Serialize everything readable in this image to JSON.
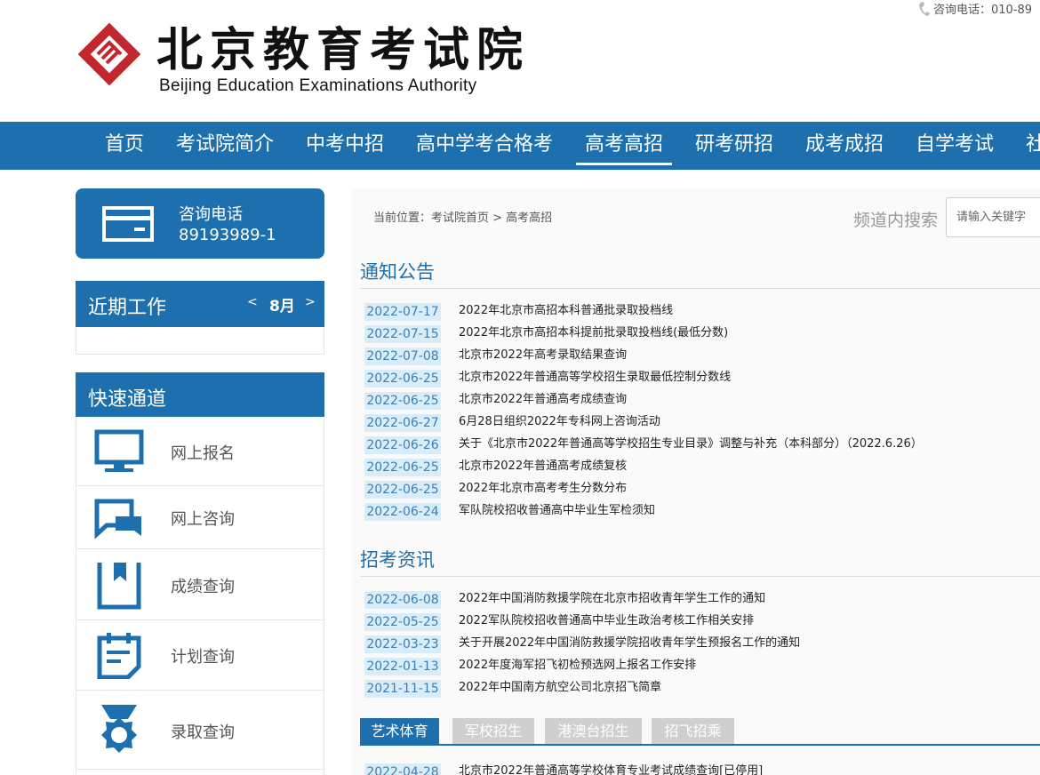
{
  "header": {
    "phone_text": "咨询电话：010-89",
    "title_cn": "北京教育考试院",
    "title_en": "Beijing Education Examinations Authority"
  },
  "nav": {
    "items": [
      "首页",
      "考试院简介",
      "中考中招",
      "高中学考合格考",
      "高考高招",
      "研考研招",
      "成考成招",
      "自学考试",
      "社"
    ],
    "active": "高考高招"
  },
  "sidebar": {
    "consult": {
      "label": "咨询电话",
      "number": "89193989-1"
    },
    "recent": {
      "title": "近期工作",
      "prev": "<",
      "month": "8月",
      "next": ">"
    },
    "quick": {
      "title": "快速通道",
      "items": [
        {
          "label": "网上报名",
          "icon": "monitor-icon"
        },
        {
          "label": "网上咨询",
          "icon": "chat-icon"
        },
        {
          "label": "成绩查询",
          "icon": "bookmark-icon"
        },
        {
          "label": "计划查询",
          "icon": "calendar-icon"
        },
        {
          "label": "录取查询",
          "icon": "medal-icon"
        }
      ]
    }
  },
  "main": {
    "breadcrumb": "当前位置：考试院首页 > 高考高招",
    "search_label": "频道内搜索",
    "search_placeholder": "请输入关键字",
    "notices": {
      "title": "通知公告",
      "items": [
        {
          "date": "2022-07-17",
          "title": "2022年北京市高招本科普通批录取投档线"
        },
        {
          "date": "2022-07-15",
          "title": "2022年北京市高招本科提前批录取投档线(最低分数)"
        },
        {
          "date": "2022-07-08",
          "title": "北京市2022年高考录取结果查询"
        },
        {
          "date": "2022-06-25",
          "title": "北京市2022年普通高等学校招生录取最低控制分数线"
        },
        {
          "date": "2022-06-25",
          "title": "北京市2022年普通高考成绩查询"
        },
        {
          "date": "2022-06-27",
          "title": "6月28日组织2022年专科网上咨询活动"
        },
        {
          "date": "2022-06-26",
          "title": "关于《北京市2022年普通高等学校招生专业目录》调整与补充（本科部分）（2022.6.26）"
        },
        {
          "date": "2022-06-25",
          "title": "北京市2022年普通高考成绩复核"
        },
        {
          "date": "2022-06-25",
          "title": "2022年北京市高考考生分数分布"
        },
        {
          "date": "2022-06-24",
          "title": "军队院校招收普通高中毕业生军检须知"
        }
      ]
    },
    "news": {
      "title": "招考资讯",
      "items": [
        {
          "date": "2022-06-08",
          "title": "2022年中国消防救援学院在北京市招收青年学生工作的通知"
        },
        {
          "date": "2022-05-25",
          "title": "2022军队院校招收普通高中毕业生政治考核工作相关安排"
        },
        {
          "date": "2022-03-23",
          "title": "关于开展2022年中国消防救援学院招收青年学生预报名工作的通知"
        },
        {
          "date": "2022-01-13",
          "title": "2022年度海军招飞初检预选网上报名工作安排"
        },
        {
          "date": "2021-11-15",
          "title": "2022年中国南方航空公司北京招飞简章"
        }
      ]
    },
    "tabs": [
      "艺术体育",
      "军校招生",
      "港澳台招生",
      "招飞招乘"
    ],
    "active_tab": "艺术体育",
    "tab_items": [
      {
        "date": "2022-04-28",
        "title": "北京市2022年普通高等学校体育专业考试成绩查询[已停用]"
      }
    ]
  },
  "colors": {
    "brand": "#1d70ad",
    "date_bg": "#d9edf9",
    "logo_red": "#c1272d"
  }
}
